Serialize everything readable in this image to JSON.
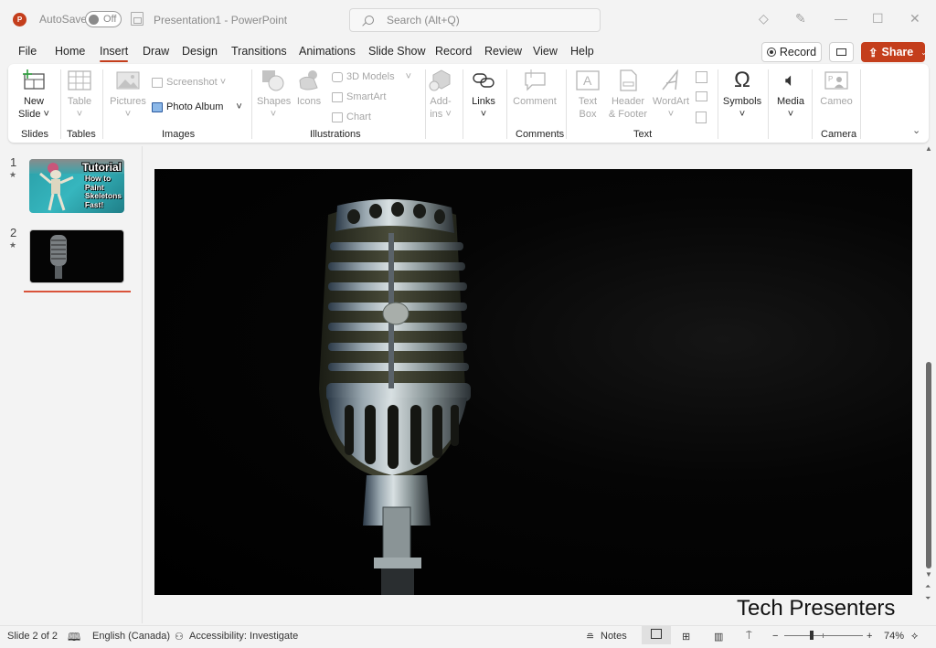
{
  "titlebar": {
    "app_icon": "powerpoint-logo",
    "autosave_label": "AutoSave",
    "autosave_state": "Off",
    "document_title": "Presentation1  -  PowerPoint",
    "search_placeholder": "Search (Alt+Q)",
    "icons": [
      "diamond-icon",
      "pen-icon",
      "minimize-icon",
      "maximize-icon",
      "close-icon"
    ]
  },
  "tabs": [
    "File",
    "Home",
    "Insert",
    "Draw",
    "Design",
    "Transitions",
    "Animations",
    "Slide Show",
    "Record",
    "Review",
    "View",
    "Help"
  ],
  "active_tab": "Insert",
  "header_buttons": {
    "record": "Record",
    "share": "Share"
  },
  "ribbon": {
    "groups": {
      "slides": "Slides",
      "tables": "Tables",
      "images": "Images",
      "illustrations": "Illustrations",
      "comments": "Comments",
      "text": "Text",
      "camera": "Camera"
    },
    "new_slide": [
      "New",
      "Slide"
    ],
    "table": "Table",
    "pictures": "Pictures",
    "screenshot": "Screenshot",
    "photo_album": "Photo Album",
    "shapes": "Shapes",
    "icons": "Icons",
    "models3d": "3D Models",
    "smartart": "SmartArt",
    "chart": "Chart",
    "addins": [
      "Add-",
      "ins"
    ],
    "links": "Links",
    "comment": "Comment",
    "textbox": [
      "Text",
      "Box"
    ],
    "header_footer": [
      "Header",
      "& Footer"
    ],
    "wordart": "WordArt",
    "symbols": "Symbols",
    "media": "Media",
    "cameo": "Cameo"
  },
  "slides_pane": {
    "slides": [
      {
        "number": "1",
        "title": "Tutorial",
        "lines": [
          "How to",
          "Paint",
          "Skeletons",
          "Fast!"
        ]
      },
      {
        "number": "2"
      }
    ]
  },
  "slide": {
    "image": "vintage-microphone-photo"
  },
  "caption": "Tech Presenters",
  "statusbar": {
    "slide_info": "Slide 2 of 2",
    "language": "English (Canada)",
    "accessibility": "Accessibility: Investigate",
    "notes": "Notes",
    "zoom": "74%",
    "zoom_fraction": 0.5
  }
}
